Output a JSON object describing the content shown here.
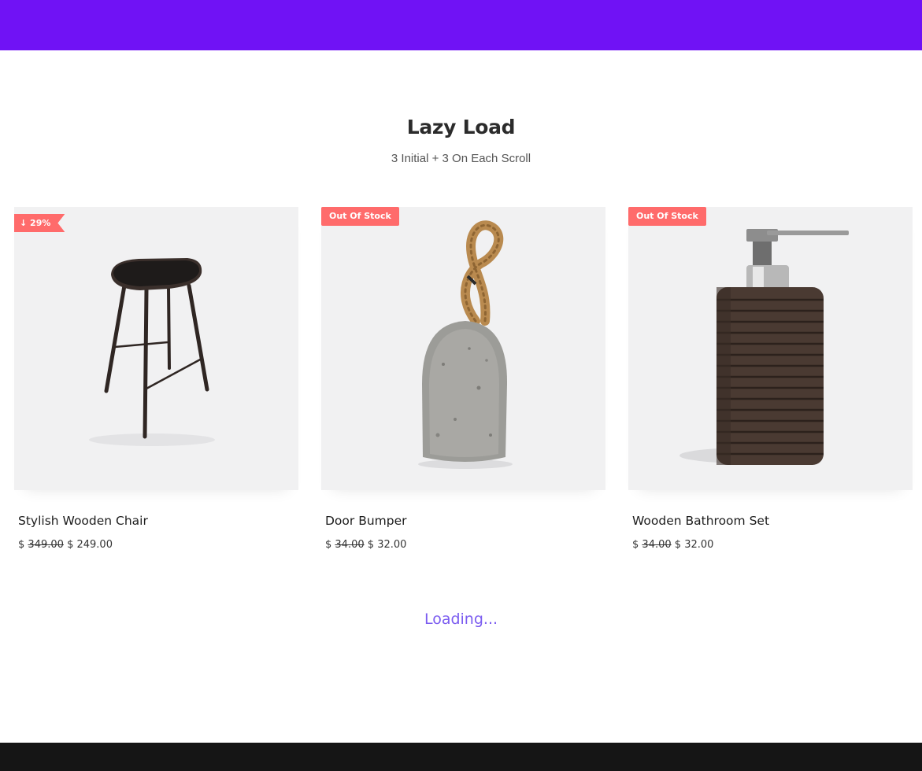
{
  "colors": {
    "header_bar": "#7012f5",
    "footer_bar": "#151515",
    "badge": "#ff6b6b",
    "loading_text": "#7b5cf0"
  },
  "section": {
    "title": "Lazy Load",
    "subtitle": "3 Initial + 3 On Each Scroll"
  },
  "products": [
    {
      "badge_icon": "arrow-down-icon",
      "badge": "↓ 29%",
      "image": "bar-stool",
      "title": "Stylish Wooden Chair",
      "currency": "$",
      "price_old": "349.00",
      "price_new": "249.00"
    },
    {
      "badge": "Out Of Stock",
      "image": "rope-door-stop",
      "title": "Door Bumper",
      "currency": "$",
      "price_old": "34.00",
      "price_new": "32.00"
    },
    {
      "badge": "Out Of Stock",
      "image": "soap-dispenser",
      "title": "Wooden Bathroom Set",
      "currency": "$",
      "price_old": "34.00",
      "price_new": "32.00"
    }
  ],
  "loading_text": "Loading..."
}
